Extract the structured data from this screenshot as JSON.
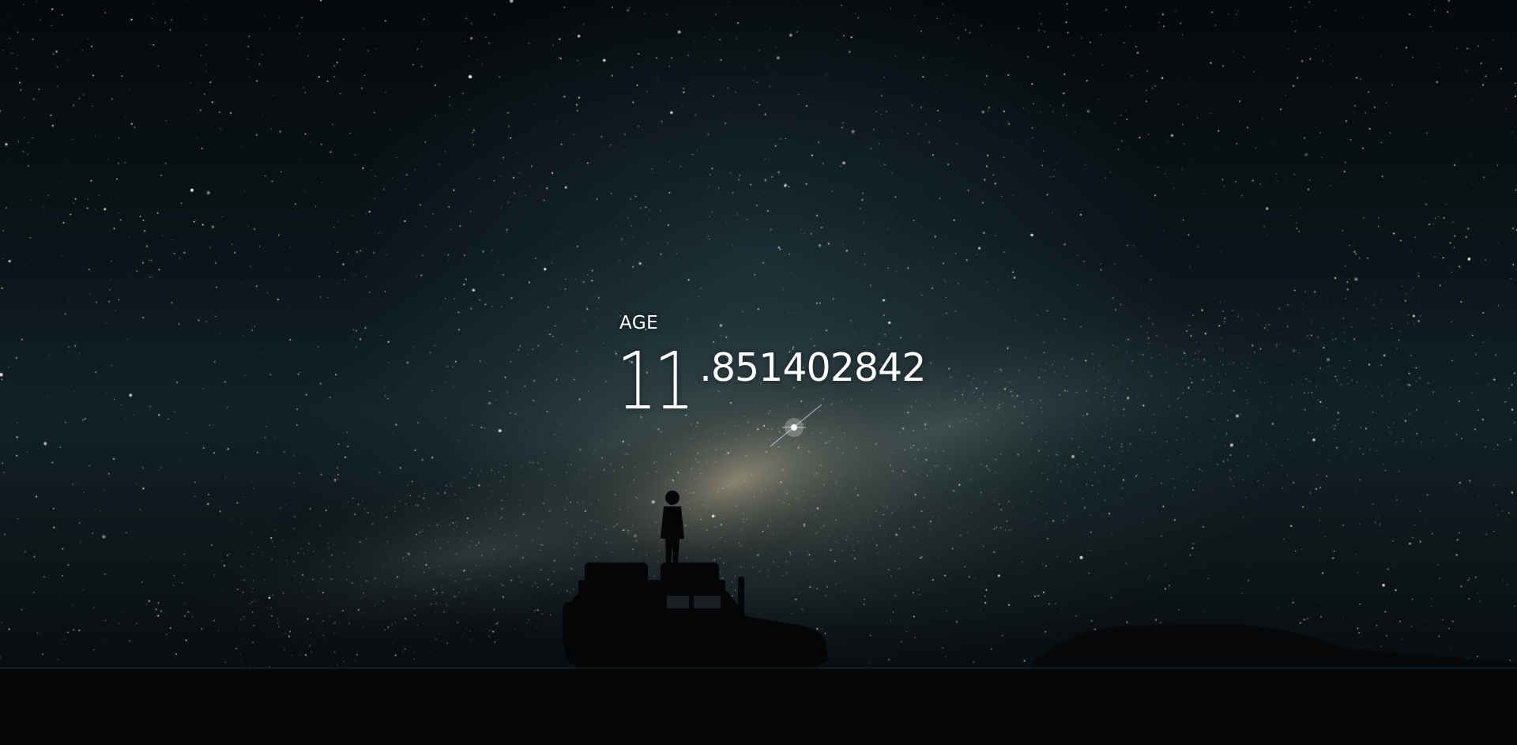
{
  "age": {
    "label": "AGE",
    "integer": "11",
    "decimal": ".851402842"
  },
  "background": {
    "scene": "night sky with milky way, silhouette of a person standing on a 4x4 vehicle on flat land",
    "sky_color": "#0b1519",
    "ground_color": "#050608"
  },
  "text_color": "#ffffff"
}
